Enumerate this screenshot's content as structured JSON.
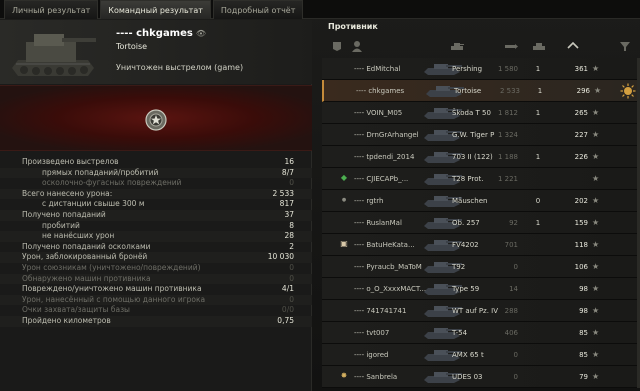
{
  "tabs": [
    "Личный результат",
    "Командный результат",
    "Подробный отчёт"
  ],
  "active_tab": 1,
  "player": {
    "name": "---- chkgames",
    "tank": "Tortoise",
    "death": "Уничтожен выстрелом (game)"
  },
  "stats": [
    {
      "label": "Произведено выстрелов",
      "value": "16",
      "indent": false,
      "dim": false
    },
    {
      "label": "прямых попаданий/пробитий",
      "value": "8/7",
      "indent": true,
      "dim": false
    },
    {
      "label": "осколочно-фугасных повреждений",
      "value": "0",
      "indent": true,
      "dim": true
    },
    {
      "label": "Всего нанесено урона:",
      "value": "2 533",
      "indent": false,
      "dim": false
    },
    {
      "label": "с дистанции свыше 300 м",
      "value": "817",
      "indent": true,
      "dim": false
    },
    {
      "label": "Получено попаданий",
      "value": "37",
      "indent": false,
      "dim": false
    },
    {
      "label": "пробитий",
      "value": "8",
      "indent": true,
      "dim": false
    },
    {
      "label": "не нанёсших урон",
      "value": "28",
      "indent": true,
      "dim": false
    },
    {
      "label": "Получено попаданий осколками",
      "value": "2",
      "indent": false,
      "dim": false
    },
    {
      "label": "Урон, заблокированный бронёй",
      "value": "10 030",
      "indent": false,
      "dim": false
    },
    {
      "label": "Урон союзникам (уничтожено/повреждений)",
      "value": "0",
      "indent": false,
      "dim": true
    },
    {
      "label": "Обнаружено машин противника",
      "value": "0",
      "indent": false,
      "dim": true
    },
    {
      "label": "Повреждено/уничтожено машин противника",
      "value": "4/1",
      "indent": false,
      "dim": false
    },
    {
      "label": "Урон, нанесённый с помощью данного игрока",
      "value": "0",
      "indent": false,
      "dim": true
    },
    {
      "label": "Очки захвата/защиты базы",
      "value": "0/0",
      "indent": false,
      "dim": true
    },
    {
      "label": "Пройдено километров",
      "value": "0,75",
      "indent": false,
      "dim": false
    }
  ],
  "enemy": {
    "title": "Противник",
    "rows": [
      {
        "name": "---- EdMitchal",
        "tank": "Pershing",
        "damage": "1 580",
        "kills": "1",
        "xp": "361",
        "self": false,
        "badge": ""
      },
      {
        "name": "---- chkgames",
        "tank": "Tortoise",
        "damage": "2 533",
        "kills": "1",
        "xp": "296",
        "self": true,
        "badge": ""
      },
      {
        "name": "---- VOIN_M05",
        "tank": "Škoda T 50",
        "damage": "1 812",
        "kills": "1",
        "xp": "265",
        "self": false,
        "badge": ""
      },
      {
        "name": "---- DrnGrArhangel",
        "tank": "G.W. Tiger P",
        "damage": "1 324",
        "kills": "",
        "xp": "227",
        "self": false,
        "badge": ""
      },
      {
        "name": "---- tpdendi_2014",
        "tank": "703 II (122)",
        "damage": "1 188",
        "kills": "1",
        "xp": "226",
        "self": false,
        "badge": ""
      },
      {
        "name": "---- CJIECAPb_...",
        "tank": "T28 Prot.",
        "damage": "1 221",
        "kills": "",
        "xp": "",
        "self": false,
        "badge": "green"
      },
      {
        "name": "---- rgtrh",
        "tank": "Mäuschen",
        "damage": "",
        "kills": "0",
        "xp": "202",
        "self": false,
        "badge": "dot"
      },
      {
        "name": "---- RuslanMal",
        "tank": "Ob. 257",
        "damage": "92",
        "kills": "1",
        "xp": "159",
        "self": false,
        "badge": ""
      },
      {
        "name": "---- BatuHeKata...",
        "tank": "FV4202",
        "damage": "701",
        "kills": "",
        "xp": "118",
        "self": false,
        "badge": "clan"
      },
      {
        "name": "---- Pyraucb_MaToM",
        "tank": "T92",
        "damage": "0",
        "kills": "",
        "xp": "106",
        "self": false,
        "badge": ""
      },
      {
        "name": "---- o_O_XxxxMACT...",
        "tank": "Type 59",
        "damage": "14",
        "kills": "",
        "xp": "98",
        "self": false,
        "badge": ""
      },
      {
        "name": "---- 741741741",
        "tank": "WT auf Pz. IV",
        "damage": "288",
        "kills": "",
        "xp": "98",
        "self": false,
        "badge": ""
      },
      {
        "name": "---- tvt007",
        "tank": "T-54",
        "damage": "406",
        "kills": "",
        "xp": "85",
        "self": false,
        "badge": ""
      },
      {
        "name": "---- igored",
        "tank": "AMX 65 t",
        "damage": "0",
        "kills": "",
        "xp": "85",
        "self": false,
        "badge": ""
      },
      {
        "name": "---- Sanbrela",
        "tank": "UDES 03",
        "damage": "0",
        "kills": "",
        "xp": "79",
        "self": false,
        "badge": "gold"
      }
    ]
  },
  "icons": [
    "eye-icon",
    "tank-portrait",
    "medal-icon",
    "rank-icon",
    "tank-type-icon",
    "damage-icon",
    "frags-icon",
    "xp-icon",
    "filter-icon",
    "star-icon"
  ],
  "colors": {
    "accent": "#c48a3a",
    "band": "#5a1410",
    "text": "#bdbdb0"
  }
}
